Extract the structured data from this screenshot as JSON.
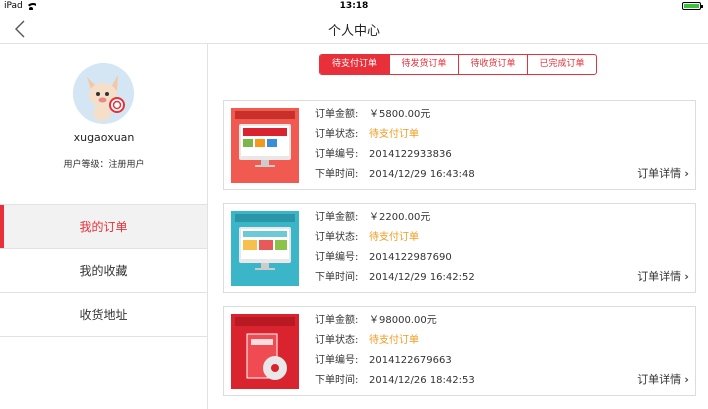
{
  "status_bar": {
    "carrier": "iPad",
    "time": "13:18",
    "battery_level": 1.0
  },
  "nav": {
    "title": "个人中心"
  },
  "profile": {
    "username": "xugaoxuan",
    "level_label": "用户等级：",
    "level_value": "注册用户"
  },
  "menu": [
    {
      "label": "我的订单",
      "active": true
    },
    {
      "label": "我的收藏",
      "active": false
    },
    {
      "label": "收货地址",
      "active": false
    }
  ],
  "tabs": [
    {
      "label": "待支付订单",
      "active": true
    },
    {
      "label": "待发货订单",
      "active": false
    },
    {
      "label": "待收货订单",
      "active": false
    },
    {
      "label": "已完成订单",
      "active": false
    }
  ],
  "field_labels": {
    "amount": "订单金额:",
    "status": "订单状态:",
    "number": "订单编号:",
    "time": "下单时间:"
  },
  "detail_label": "订单详情",
  "orders": [
    {
      "amount": "￥5800.00元",
      "status": "待支付订单",
      "number": "2014122933836",
      "time": "2014/12/29 16:43:48",
      "thumb_color": "#f05a50"
    },
    {
      "amount": "￥2200.00元",
      "status": "待支付订单",
      "number": "2014122987690",
      "time": "2014/12/29 16:42:52",
      "thumb_color": "#3ab6c8"
    },
    {
      "amount": "￥98000.00元",
      "status": "待支付订单",
      "number": "2014122679663",
      "time": "2014/12/26 18:42:53",
      "thumb_color": "#d9232e"
    }
  ]
}
